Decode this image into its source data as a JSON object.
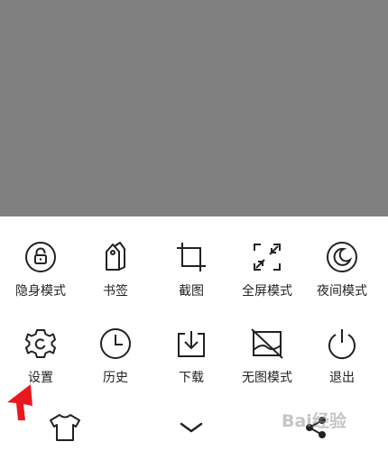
{
  "menu": {
    "row1": [
      {
        "label": "隐身模式",
        "icon": "incognito-lock-icon"
      },
      {
        "label": "书签",
        "icon": "bookmark-tag-icon"
      },
      {
        "label": "截图",
        "icon": "crop-icon"
      },
      {
        "label": "全屏模式",
        "icon": "fullscreen-icon"
      },
      {
        "label": "夜间模式",
        "icon": "moon-icon"
      }
    ],
    "row2": [
      {
        "label": "设置",
        "icon": "gear-icon"
      },
      {
        "label": "历史",
        "icon": "clock-icon"
      },
      {
        "label": "下载",
        "icon": "download-icon"
      },
      {
        "label": "无图模式",
        "icon": "no-image-icon"
      },
      {
        "label": "退出",
        "icon": "power-icon"
      }
    ]
  },
  "bottom_bar": {
    "left_icon": "tshirt-icon",
    "center_icon": "chevron-down-icon",
    "right_icon": "share-icon"
  },
  "watermark": {
    "text": "Bai经验"
  },
  "colors": {
    "overlay": "#808080",
    "icon_stroke": "#222222",
    "annotation_arrow": "#e8191e"
  }
}
